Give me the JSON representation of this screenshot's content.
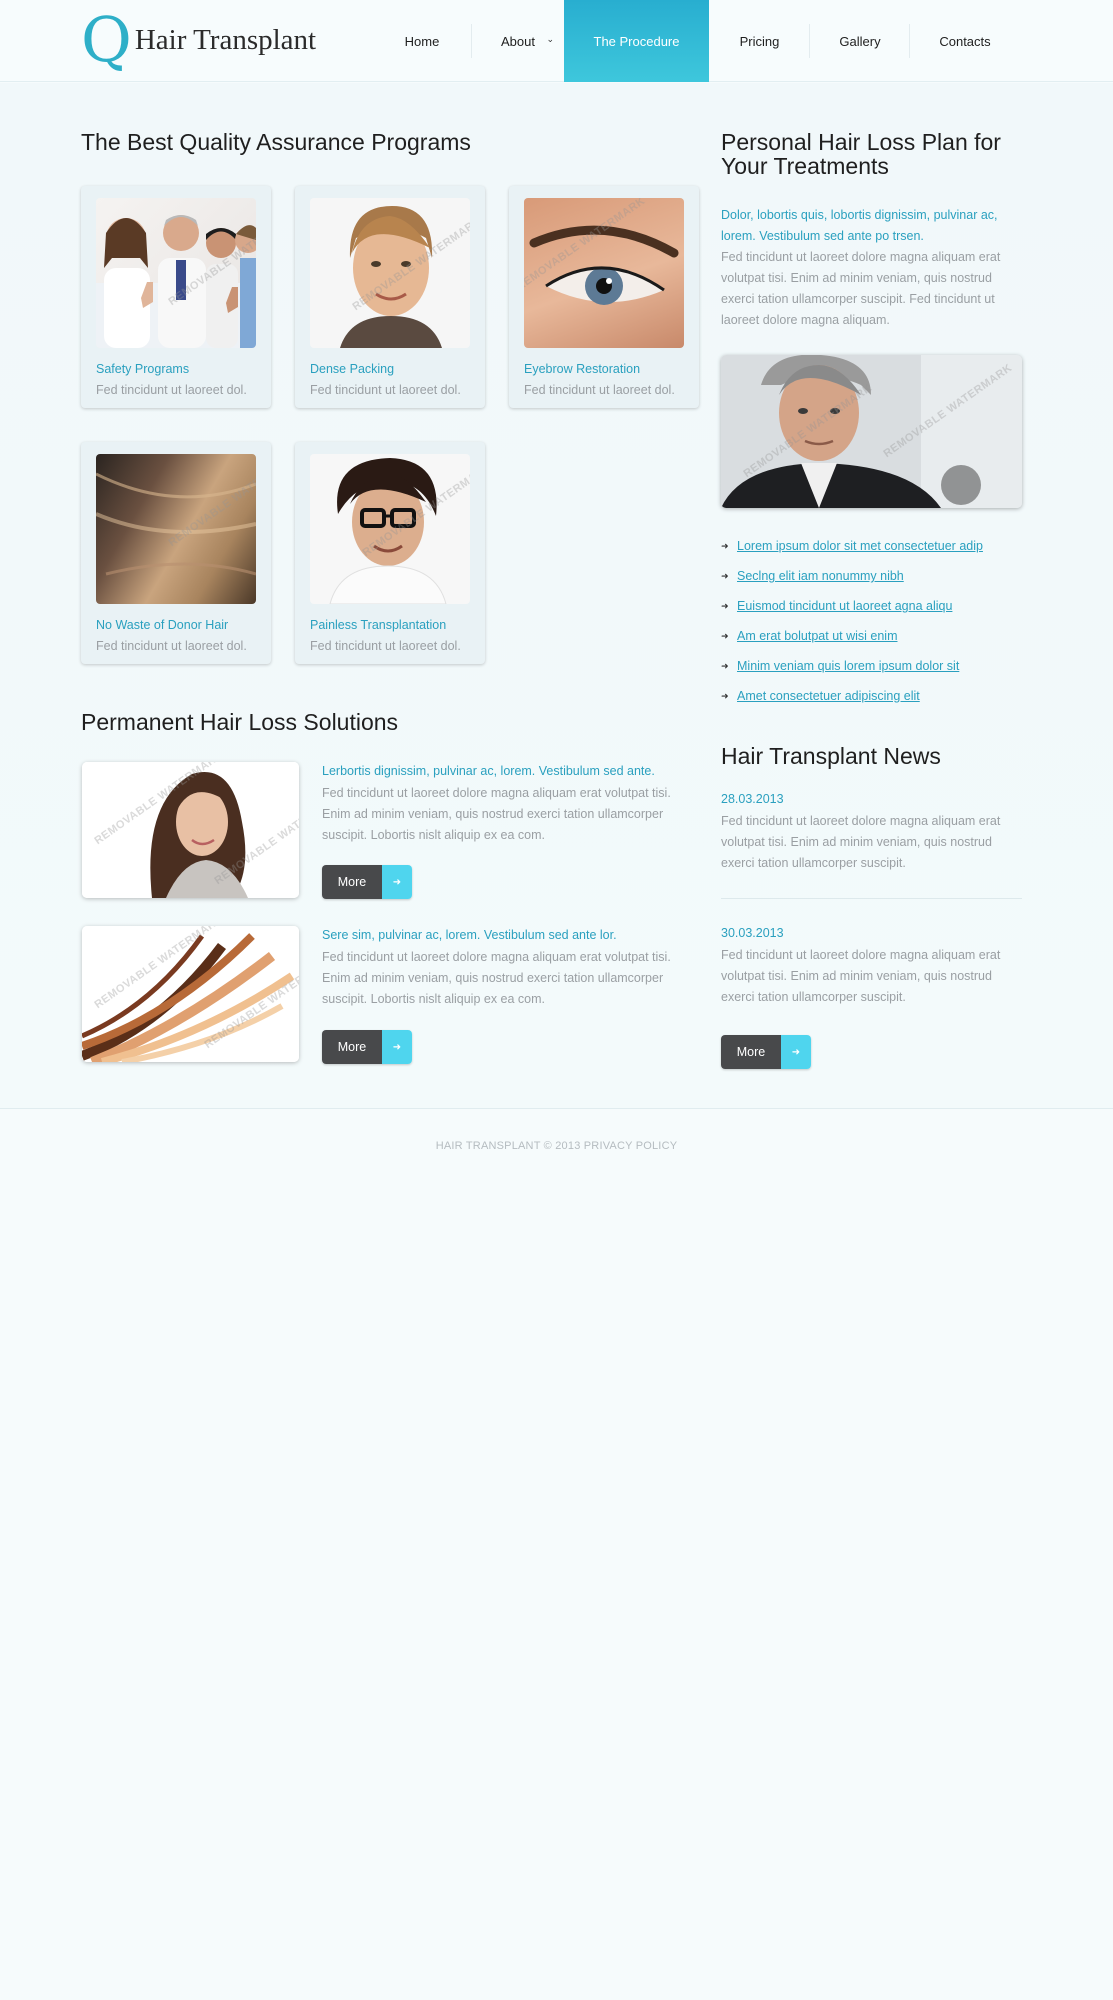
{
  "brand": {
    "logo_letter": "Q",
    "logo_name": "Hair Transplant"
  },
  "nav": {
    "items": [
      {
        "label": "Home"
      },
      {
        "label": "About"
      },
      {
        "label": "The Procedure"
      },
      {
        "label": "Pricing"
      },
      {
        "label": "Gallery"
      },
      {
        "label": "Contacts"
      }
    ],
    "active": "The Procedure"
  },
  "quality": {
    "heading": "The Best Quality Assurance Programs",
    "cards": [
      {
        "title": "Safety Programs",
        "desc": "Fed tincidunt ut laoreet dol."
      },
      {
        "title": "Dense Packing",
        "desc": "Fed tincidunt ut laoreet dol."
      },
      {
        "title": "Eyebrow Restoration",
        "desc": "Fed tincidunt ut laoreet dol."
      },
      {
        "title": "No Waste of Donor Hair",
        "desc": "Fed tincidunt ut laoreet dol."
      },
      {
        "title": "Painless Transplantation",
        "desc": "Fed tincidunt ut laoreet dol."
      }
    ]
  },
  "solutions": {
    "heading": "Permanent Hair Loss Solutions",
    "items": [
      {
        "title": "Lerbortis dignissim, pulvinar ac, lorem. Vestibulum sed ante.",
        "text": "Fed tincidunt ut laoreet dolore magna aliquam erat volutpat tisi. Enim ad minim veniam, quis nostrud exerci tation ullamcorper suscipit. Lobortis nislt aliquip ex ea com.",
        "button": "More"
      },
      {
        "title": "Sere sim, pulvinar ac, lorem. Vestibulum sed ante lor.",
        "text": "Fed tincidunt ut laoreet dolore magna aliquam erat volutpat tisi. Enim ad minim veniam, quis nostrud exerci tation ullamcorper suscipit. Lobortis nislt aliquip ex ea com.",
        "button": "More"
      }
    ]
  },
  "plan": {
    "heading": "Personal Hair Loss Plan for Your Treatments",
    "lead": "Dolor, lobortis quis, lobortis dignissim, pulvinar ac, lorem. Vestibulum sed ante po trsen.",
    "text": "Fed tincidunt ut laoreet dolore magna aliquam erat volutpat tisi. Enim ad minim veniam, quis nostrud exerci tation ullamcorper suscipit. Fed tincidunt ut laoreet dolore magna aliquam.",
    "links": [
      "Lorem ipsum dolor sit met consectetuer adip",
      "Seclng elit iam nonummy nibh",
      "Euismod tincidunt ut laoreet agna aliqu",
      "Am erat bolutpat ut wisi enim",
      "Minim veniam quis lorem ipsum dolor sit",
      "Amet consectetuer adipiscing elit"
    ]
  },
  "news": {
    "heading": "Hair Transplant News",
    "items": [
      {
        "date": "28.03.2013",
        "text": "Fed tincidunt ut laoreet dolore magna aliquam erat volutpat tisi. Enim ad minim veniam, quis nostrud exerci tation ullamcorper suscipit."
      },
      {
        "date": "30.03.2013",
        "text": "Fed tincidunt ut laoreet dolore magna aliquam erat volutpat tisi. Enim ad minim veniam, quis nostrud exerci tation ullamcorper suscipit."
      }
    ],
    "button": "More"
  },
  "watermark": "REMOVABLE WATERMARK",
  "footer": {
    "text": "HAIR TRANSPLANT © 2013 PRIVACY POLICY"
  },
  "colors": {
    "accent": "#2aa0bf",
    "nav_active": "#33bad5",
    "button_dark": "#48494b",
    "button_accent": "#4fd5ee"
  },
  "icons": {
    "list_bullet": "arrow-right-icon",
    "button_arrow": "arrow-right-icon",
    "nav_dropdown": "chevron-down-icon"
  }
}
